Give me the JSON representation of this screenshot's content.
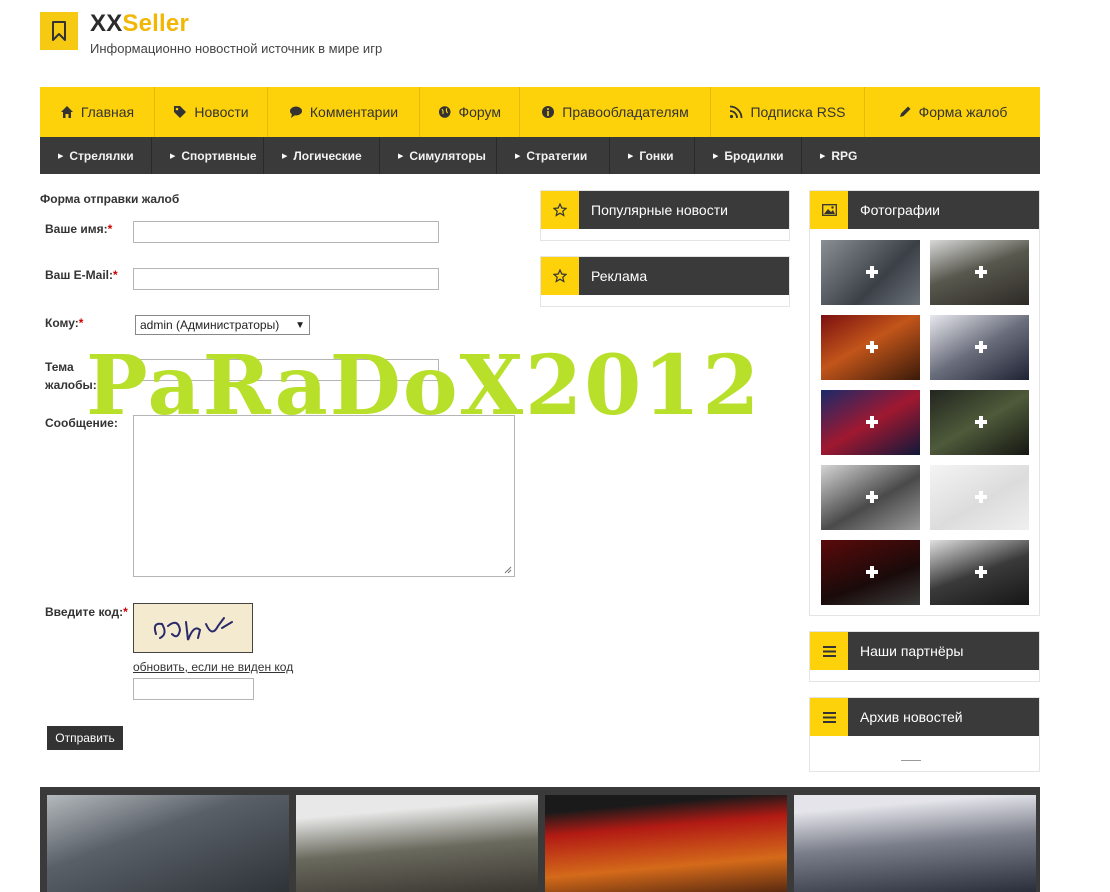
{
  "header": {
    "title_part1": "XX",
    "title_part2": "Seller",
    "tagline": "Информационно новостной источник в мире игр",
    "logo_icon": "bookmark-icon"
  },
  "nav": {
    "main": [
      {
        "label": "Главная",
        "icon": "home-icon"
      },
      {
        "label": "Новости",
        "icon": "tag-icon"
      },
      {
        "label": "Комментарии",
        "icon": "comment-icon"
      },
      {
        "label": "Форум",
        "icon": "globe-icon"
      },
      {
        "label": "Правообладателям",
        "icon": "info-icon"
      },
      {
        "label": "Подписка RSS",
        "icon": "rss-icon"
      },
      {
        "label": "Форма жалоб",
        "icon": "pencil-icon"
      }
    ],
    "sub": [
      "Стрелялки",
      "Спортивные",
      "Логические",
      "Симуляторы",
      "Стратегии",
      "Гонки",
      "Бродилки",
      "RPG"
    ]
  },
  "form": {
    "title": "Форма отправки жалоб",
    "name_label": "Ваше имя:",
    "email_label": "Ваш E-Mail:",
    "to_label": "Кому:",
    "to_selected": "admin (Администраторы)",
    "subject_label_line1": "Тема",
    "subject_label_line2": "жалобы:",
    "message_label": "Сообщение:",
    "code_label": "Введите код:",
    "required_mark": "*",
    "refresh_link": "обновить, если не виден код",
    "submit": "Отправить"
  },
  "widgets": {
    "popular": "Популярные новости",
    "ads": "Реклама",
    "photos": "Фотографии",
    "partners": "Наши партнёры",
    "archive": "Архив новостей"
  },
  "watermark": "PaRaDoX2012",
  "colors": {
    "accent": "#fdd20a",
    "dark": "#3a3a3a",
    "watermark": "#b8e02a"
  }
}
